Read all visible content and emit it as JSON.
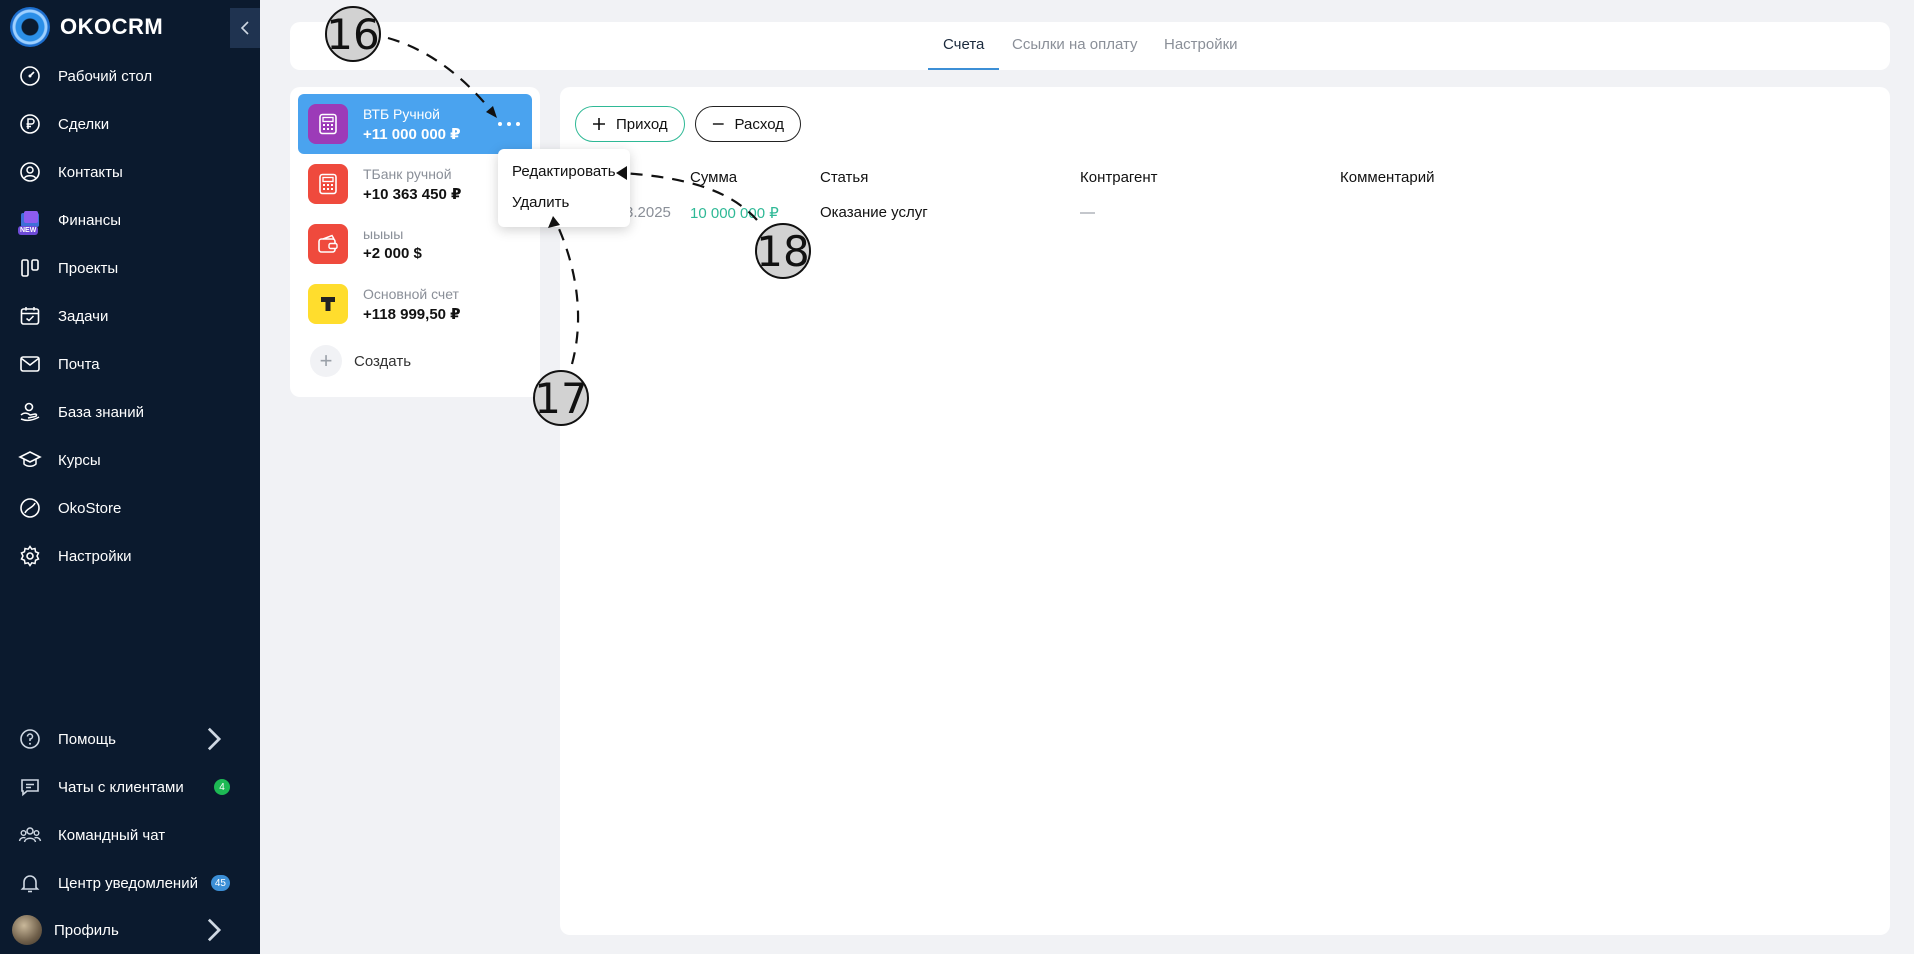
{
  "app": {
    "logo_text": "OKOCRM"
  },
  "sidebar": {
    "items": [
      {
        "label": "Рабочий стол",
        "icon": "dashboard-icon"
      },
      {
        "label": "Сделки",
        "icon": "ruble-icon"
      },
      {
        "label": "Контакты",
        "icon": "user-circle-icon"
      },
      {
        "label": "Финансы",
        "icon": "finance-icon",
        "badge": "NEW"
      },
      {
        "label": "Проекты",
        "icon": "projects-icon"
      },
      {
        "label": "Задачи",
        "icon": "calendar-icon"
      },
      {
        "label": "Почта",
        "icon": "mail-icon"
      },
      {
        "label": "База знаний",
        "icon": "knowledge-icon"
      },
      {
        "label": "Курсы",
        "icon": "graduation-cap-icon"
      },
      {
        "label": "OkoStore",
        "icon": "store-icon"
      },
      {
        "label": "Настройки",
        "icon": "gear-icon"
      }
    ],
    "bottom": [
      {
        "label": "Помощь",
        "icon": "help-icon"
      },
      {
        "label": "Чаты с клиентами",
        "icon": "chat-icon",
        "count": "4"
      },
      {
        "label": "Командный чат",
        "icon": "team-icon"
      },
      {
        "label": "Центр уведомлений",
        "icon": "bell-icon",
        "count": "45"
      },
      {
        "label": "Профиль",
        "icon": "avatar"
      }
    ]
  },
  "tabs": [
    {
      "label": "Счета",
      "active": true
    },
    {
      "label": "Ссылки на оплату"
    },
    {
      "label": "Настройки"
    }
  ],
  "accounts": [
    {
      "name": "ВТБ Ручной",
      "sum": "+11 000 000 ₽",
      "icon": "calculator-icon",
      "color": "#9c3bb8",
      "selected": true
    },
    {
      "name": "ТБанк ручной",
      "sum": "+10 363 450 ₽",
      "icon": "calculator-icon",
      "color": "#ef4a3d"
    },
    {
      "name": "ыыыы",
      "sum": "+2 000 $",
      "icon": "wallet-icon",
      "color": "#ef4a3d"
    },
    {
      "name": "Основной счет",
      "sum": "+118 999,50 ₽",
      "icon": "tbank-logo-icon",
      "color": "#ffdd2d"
    }
  ],
  "create_label": "Создать",
  "buttons": {
    "income": "Приход",
    "expense": "Расход"
  },
  "table": {
    "headers": [
      "Сумма",
      "Статья",
      "Контрагент",
      "Комментарий"
    ],
    "row": {
      "date_partial": "3.2025",
      "sum": "10 000 000 ₽",
      "article": "Оказание услуг",
      "counterparty": "—",
      "comment": ""
    }
  },
  "menu": {
    "edit": "Редактировать",
    "delete": "Удалить"
  },
  "callouts": [
    "16",
    "17",
    "18"
  ],
  "colors": {
    "sidebar": "#0b1a2e",
    "accent": "#4aa3ef",
    "income": "#2fb996"
  }
}
